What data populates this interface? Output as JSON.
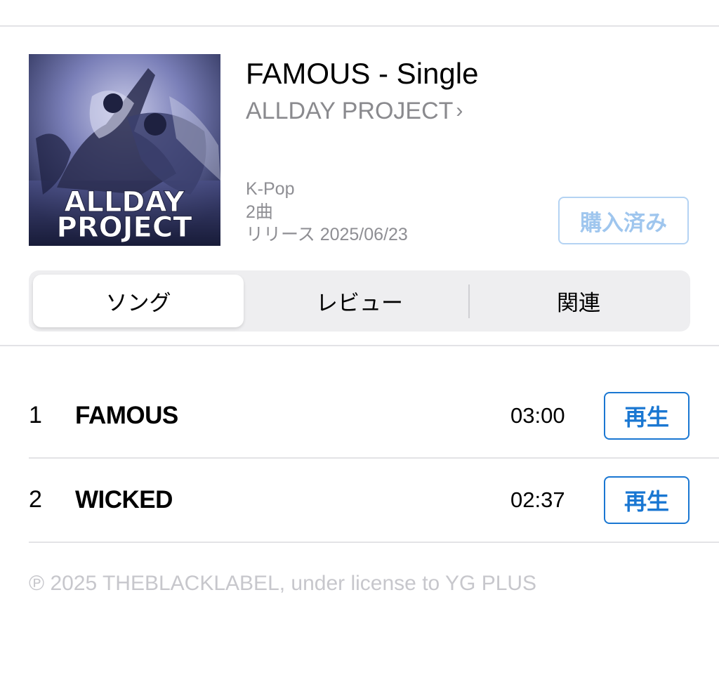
{
  "album": {
    "title": "FAMOUS - Single",
    "artist": "ALLDAY PROJECT",
    "artist_chevron": "›",
    "artwork_text_line1": "ALLDAY",
    "artwork_text_line2": "PROJECT",
    "genre": "K-Pop",
    "track_count": "2曲",
    "release": "リリース 2025/06/23",
    "purchased_label": "購入済み"
  },
  "tabs": [
    {
      "label": "ソング",
      "selected": true
    },
    {
      "label": "レビュー",
      "selected": false
    },
    {
      "label": "関連",
      "selected": false
    }
  ],
  "tracks": [
    {
      "number": "1",
      "title": "FAMOUS",
      "duration": "03:00",
      "action": "再生"
    },
    {
      "number": "2",
      "title": "WICKED",
      "duration": "02:37",
      "action": "再生"
    }
  ],
  "copyright": "℗ 2025 THEBLACKLABEL, under license to YG PLUS",
  "colors": {
    "accent": "#1a77d2",
    "accent_disabled": "#9fc6ee",
    "secondary_text": "#8e8e93",
    "footer_text": "#c7c7cc",
    "segment_bg": "#eeeef0"
  },
  "icons": {
    "artist_link": "chevron-right-icon"
  }
}
